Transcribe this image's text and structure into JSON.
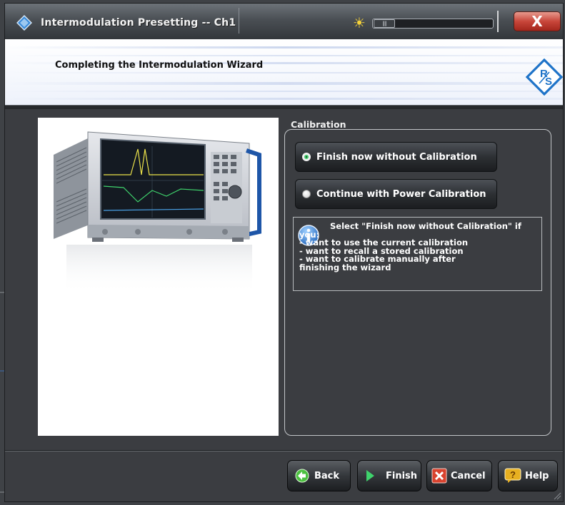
{
  "window": {
    "title": "Intermodulation Presetting -- Ch1",
    "close_label": "X"
  },
  "brightness": {
    "icon": "sun-icon",
    "thumb_label": "||||",
    "level_fraction": 0.1
  },
  "header": {
    "title": "Completing the Intermodulation Wizard",
    "logo": "R&S"
  },
  "calibration": {
    "group_title": "Calibration",
    "options": [
      {
        "label": "Finish now without Calibration",
        "selected": true
      },
      {
        "label": "Continue with Power Calibration",
        "selected": false
      }
    ],
    "info_text": "Select \"Finish now without Calibration\" if you:\n- want to use the current calibration\n- want to recall a stored calibration\n- want to calibrate manually after\nfinishing the wizard"
  },
  "footer": {
    "back": "Back",
    "finish": "Finish",
    "cancel": "Cancel",
    "help": "Help"
  },
  "colors": {
    "dialog_bg": "#3b3d41",
    "selected_radio": "#3fd36c",
    "back_icon": "#4cc040",
    "finish_icon": "#3fd36c",
    "cancel_icon": "#d9432f",
    "help_icon": "#e8b020"
  }
}
